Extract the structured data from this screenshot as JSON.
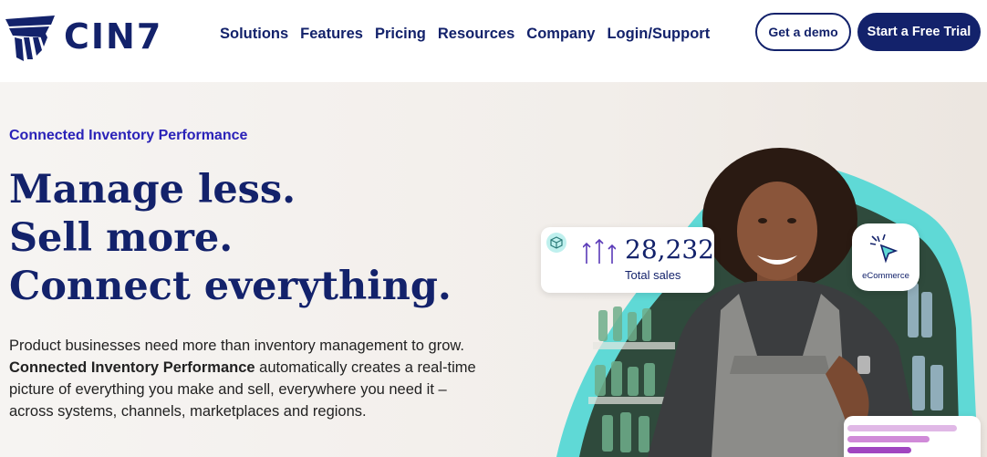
{
  "brand": {
    "name": "CIN7",
    "color": "#13226b",
    "accent": "#2a22b8",
    "teal": "#5fd9d6"
  },
  "nav": {
    "items": [
      {
        "label": "Solutions"
      },
      {
        "label": "Features"
      },
      {
        "label": "Pricing"
      },
      {
        "label": "Resources"
      },
      {
        "label": "Company"
      },
      {
        "label": "Login/Support"
      }
    ],
    "demo_label": "Get a demo",
    "trial_label": "Start a Free Trial"
  },
  "hero": {
    "eyebrow": "Connected Inventory Performance",
    "headline": [
      "Manage less.",
      "Sell more.",
      "Connect everything."
    ],
    "body_intro": "Product businesses need more than inventory management to grow.",
    "body_bold": "Connected Inventory Performance",
    "body_rest": " automatically creates a real-time picture of everything you make and sell, everywhere you need it – across systems, channels, marketplaces and regions."
  },
  "stats_card": {
    "value": "28,232",
    "label": "Total sales",
    "icons": [
      "cube-icon",
      "growth-arrows-icon"
    ]
  },
  "ecommerce_card": {
    "label": "eCommerce",
    "icon": "cursor-click-icon"
  }
}
